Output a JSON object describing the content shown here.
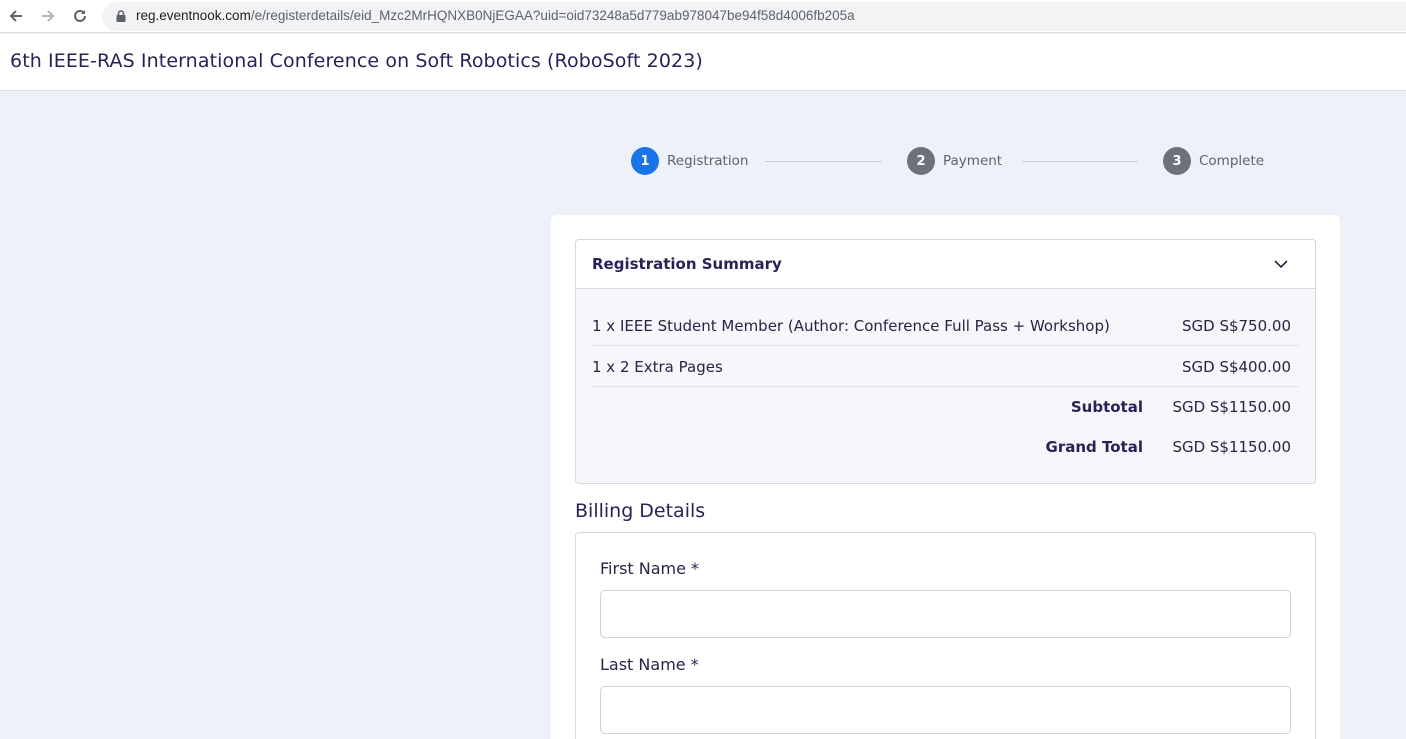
{
  "browser": {
    "url_domain": "reg.eventnook.com",
    "url_path": "/e/registerdetails/eid_Mzc2MrHQNXB0NjEGAA?uid=oid73248a5d779ab978047be94f58d4006fb205a"
  },
  "header": {
    "title": "6th IEEE-RAS International Conference on Soft Robotics (RoboSoft 2023)"
  },
  "stepper": {
    "steps": [
      {
        "number": "1",
        "label": "Registration",
        "state": "active"
      },
      {
        "number": "2",
        "label": "Payment",
        "state": "inactive"
      },
      {
        "number": "3",
        "label": "Complete",
        "state": "inactive"
      }
    ]
  },
  "summary": {
    "title": "Registration Summary",
    "items": [
      {
        "description": "1 x IEEE Student Member (Author: Conference Full Pass + Workshop)",
        "amount": "SGD S$750.00"
      },
      {
        "description": "1 x 2 Extra Pages",
        "amount": "SGD S$400.00"
      }
    ],
    "subtotal_label": "Subtotal",
    "subtotal_amount": "SGD S$1150.00",
    "grand_total_label": "Grand Total",
    "grand_total_amount": "SGD S$1150.00"
  },
  "billing": {
    "title": "Billing Details",
    "first_name_label": "First Name *",
    "first_name_value": "",
    "last_name_label": "Last Name *",
    "last_name_value": ""
  },
  "colors": {
    "accent": "#1a73e8",
    "inactive_step": "#6c727c",
    "title_text": "#2a1f57",
    "page_background": "#edf1f8"
  }
}
